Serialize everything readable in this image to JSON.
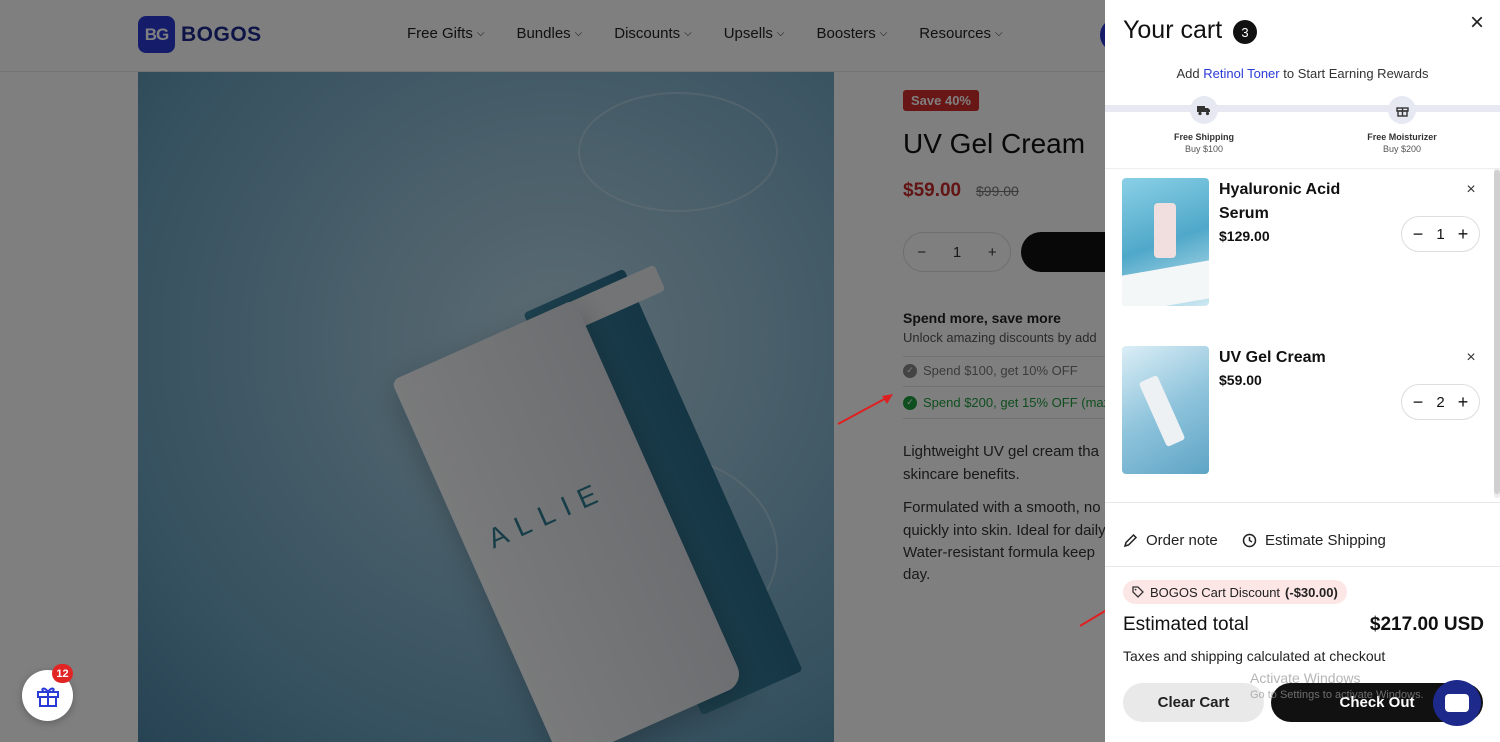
{
  "header": {
    "logo_mark": "BG",
    "logo_text": "BOGOS",
    "nav": [
      {
        "label": "Free Gifts"
      },
      {
        "label": "Bundles"
      },
      {
        "label": "Discounts"
      },
      {
        "label": "Upsells"
      },
      {
        "label": "Boosters"
      },
      {
        "label": "Resources"
      }
    ]
  },
  "product": {
    "badge": "Save 40%",
    "title": "UV Gel Cream",
    "price": "$59.00",
    "compare_price": "$99.00",
    "quantity": "1",
    "image_text": "ALLIE",
    "spend_title": "Spend more, save more",
    "spend_subtitle": "Unlock amazing discounts by add",
    "tiers": [
      {
        "label": "Spend $100, get 10% OFF"
      },
      {
        "label": "Spend $200, get 15% OFF (max"
      }
    ],
    "description": [
      "Lightweight UV gel cream tha",
      "skincare benefits.",
      "Formulated with a smooth, no",
      "quickly into skin. Ideal for daily",
      "Water-resistant formula keep",
      "day."
    ]
  },
  "gift_fab": {
    "badge": "12"
  },
  "cart": {
    "title": "Your cart",
    "count": "3",
    "reward_prefix": "Add ",
    "reward_link": "Retinol Toner",
    "reward_suffix": " to Start Earning Rewards",
    "milestones": [
      {
        "label": "Free Shipping",
        "sub": "Buy $100",
        "icon": "truck-icon"
      },
      {
        "label": "Free Moisturizer",
        "sub": "Buy $200",
        "icon": "gift-icon"
      }
    ],
    "items": [
      {
        "name": "Hyaluronic Acid Serum",
        "price": "$129.00",
        "quantity": "1"
      },
      {
        "name": "UV Gel Cream",
        "price": "$59.00",
        "quantity": "2"
      }
    ],
    "order_note": "Order note",
    "estimate_shipping": "Estimate Shipping",
    "discount_label": "BOGOS Cart Discount",
    "discount_amount": "(-$30.00)",
    "estimated_total_label": "Estimated total",
    "estimated_total_value": "$217.00 USD",
    "tax_note": "Taxes and shipping calculated at checkout",
    "clear_label": "Clear Cart",
    "checkout_label": "Check Out"
  },
  "watermark": {
    "title": "Activate Windows",
    "subtitle": "Go to Settings to activate Windows."
  },
  "colors": {
    "brand": "#2a3ad6",
    "sale": "#c62828",
    "success": "#1f9d3c",
    "discount_bg": "#fde6e6"
  }
}
